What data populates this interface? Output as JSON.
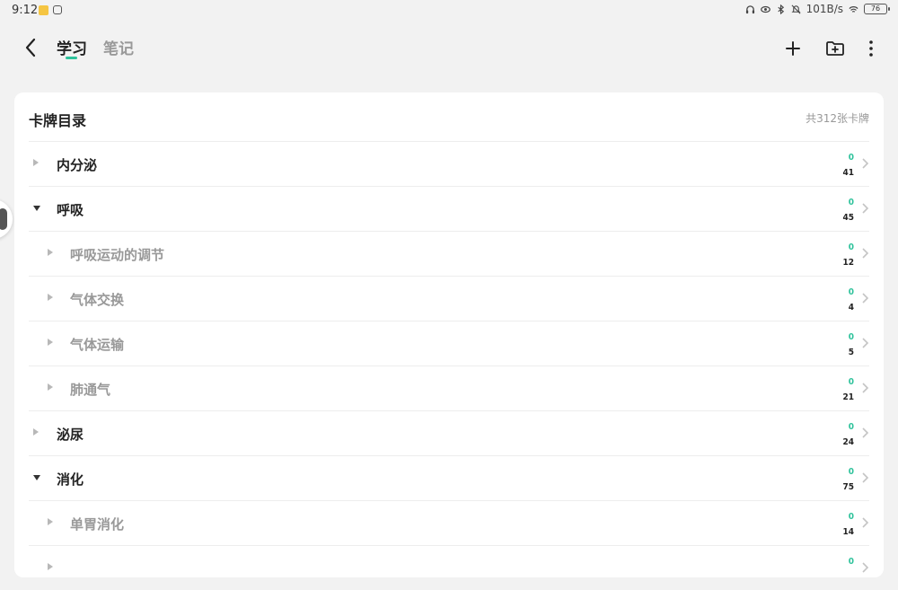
{
  "status": {
    "time": "9:12",
    "net_speed": "101B/s",
    "battery": "76"
  },
  "nav": {
    "tab_study": "学习",
    "tab_notes": "笔记"
  },
  "catalog": {
    "title": "卡牌目录",
    "count": "共312张卡牌",
    "rows": [
      {
        "label": "内分泌",
        "level": 1,
        "expanded": false,
        "new": "0",
        "total": "41"
      },
      {
        "label": "呼吸",
        "level": 1,
        "expanded": true,
        "new": "0",
        "total": "45"
      },
      {
        "label": "呼吸运动的调节",
        "level": 2,
        "expanded": false,
        "new": "0",
        "total": "12"
      },
      {
        "label": "气体交换",
        "level": 2,
        "expanded": false,
        "new": "0",
        "total": "4"
      },
      {
        "label": "气体运输",
        "level": 2,
        "expanded": false,
        "new": "0",
        "total": "5"
      },
      {
        "label": "肺通气",
        "level": 2,
        "expanded": false,
        "new": "0",
        "total": "21"
      },
      {
        "label": "泌尿",
        "level": 1,
        "expanded": false,
        "new": "0",
        "total": "24"
      },
      {
        "label": "消化",
        "level": 1,
        "expanded": true,
        "new": "0",
        "total": "75"
      },
      {
        "label": "单胃消化",
        "level": 2,
        "expanded": false,
        "new": "0",
        "total": "14"
      },
      {
        "label": "",
        "level": 2,
        "expanded": false,
        "new": "0",
        "total": ""
      }
    ]
  }
}
